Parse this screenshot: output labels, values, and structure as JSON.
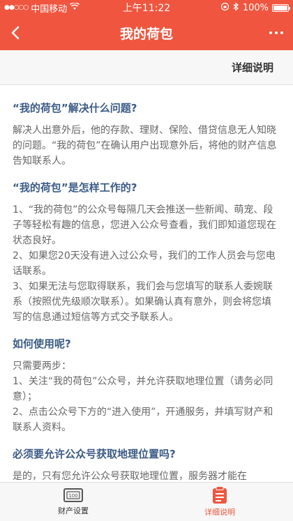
{
  "status_bar": {
    "carrier": "中国移动",
    "time": "上午11:22",
    "battery": "100%",
    "battery_level": 1.0
  },
  "nav": {
    "title": "我的荷包"
  },
  "section_header": {
    "label": "详细说明"
  },
  "faq": [
    {
      "question": "“我的荷包”解决什么问题?",
      "answer": [
        "解决人出意外后，他的存款、理财、保险、借贷信息无人知晓的问题。“我的荷包”在确认用户出现意外后，将他的财产信息告知联系人。"
      ]
    },
    {
      "question": "“我的荷包”是怎样工作的?",
      "answer": [
        "1、“我的荷包”的公众号每隔几天会推送一些新闻、萌宠、段子等轻松有趣的信息，您进入公众号查看，我们即知道您现在状态良好。",
        "2、如果您20天没有进入过公众号，我们的工作人员会与您电话联系。",
        "3、如果无法与您取得联系，我们会与您填写的联系人委婉联系（按照优先级顺次联系）。如果确认真有意外，则会将您填写的信息通过短信等方式交予联系人。"
      ]
    },
    {
      "question": "如何使用呢?",
      "answer": [
        "只需要两步：",
        "1、关注“我的荷包”公众号，并允许获取地理位置（请务必同意）；",
        "2、点击公众号下方的“进入使用”，开通服务，并填写财产和联系人资料。"
      ]
    },
    {
      "question": "必须要允许公众号获取地理位置吗?",
      "answer": [
        "是的，只有您允许公众号获取地理位置，服务器才能在"
      ]
    }
  ],
  "tabs": [
    {
      "label": "财产设置",
      "icon": "wallet-icon",
      "active": false
    },
    {
      "label": "详细说明",
      "icon": "clipboard-icon",
      "active": true
    }
  ],
  "colors": {
    "accent": "#f0563f",
    "question": "#3b5b86",
    "body_text": "#666666"
  }
}
